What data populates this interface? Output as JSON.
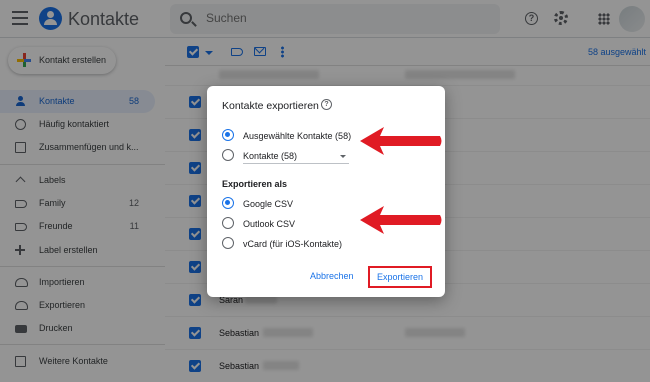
{
  "app": {
    "title": "Kontakte",
    "search_placeholder": "Suchen"
  },
  "sidebar": {
    "create_label": "Kontakt erstellen",
    "items": [
      {
        "label": "Kontakte",
        "count": "58",
        "icon": "person-icon",
        "active": true
      },
      {
        "label": "Häufig kontaktiert",
        "count": "",
        "icon": "history-icon"
      },
      {
        "label": "Zusammenfügen und k...",
        "count": "",
        "icon": "merge-icon"
      },
      {
        "label": "Labels",
        "count": "",
        "icon": "chevron-up-icon"
      },
      {
        "label": "Family",
        "count": "12",
        "icon": "label-icon"
      },
      {
        "label": "Freunde",
        "count": "11",
        "icon": "label-icon"
      },
      {
        "label": "Label erstellen",
        "count": "",
        "icon": "plus-icon"
      },
      {
        "label": "Importieren",
        "count": "",
        "icon": "upload-icon"
      },
      {
        "label": "Exportieren",
        "count": "",
        "icon": "cloud-download-icon"
      },
      {
        "label": "Drucken",
        "count": "",
        "icon": "print-icon"
      },
      {
        "label": "Weitere Kontakte",
        "count": "",
        "icon": "contacts-icon"
      }
    ]
  },
  "toolbar": {
    "selected_text": "58 ausgewählt"
  },
  "rows": [
    {
      "name": "Saran"
    },
    {
      "name": "Sebastian"
    },
    {
      "name": "Sebastian"
    }
  ],
  "dialog": {
    "title": "Kontakte exportieren",
    "help_glyph": "?",
    "option_selected": "Ausgewählte Kontakte (58)",
    "option_contacts": "Kontakte (58)",
    "export_as_heading": "Exportieren als",
    "formats": [
      "Google CSV",
      "Outlook CSV",
      "vCard (für iOS-Kontakte)"
    ],
    "cancel_label": "Abbrechen",
    "export_label": "Exportieren"
  },
  "colors": {
    "accent": "#1a73e8",
    "annotation_red": "#e01b24"
  }
}
